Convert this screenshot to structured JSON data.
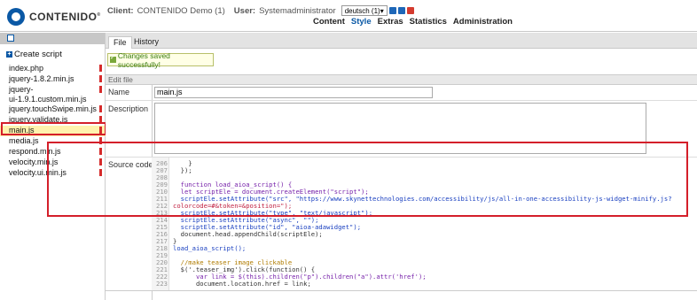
{
  "header": {
    "logo_text": "CONTENIDO",
    "client_label": "Client:",
    "client_value": "CONTENIDO Demo (1)",
    "user_label": "User:",
    "user_value": "Systemadministrator",
    "language": "deutsch (1)",
    "nav": [
      "Content",
      "Style",
      "Extras",
      "Statistics",
      "Administration"
    ],
    "active_nav": "Style"
  },
  "sidebar": {
    "create_label": "Create script",
    "files": [
      {
        "name": "index.php",
        "tall": false
      },
      {
        "name": "jquery-1.8.2.min.js",
        "tall": false
      },
      {
        "name": "jquery-\nui-1.9.1.custom.min.js",
        "tall": true
      },
      {
        "name": "jquery.touchSwipe.min.js",
        "tall": false
      },
      {
        "name": "jquery.validate.js",
        "tall": false
      },
      {
        "name": "main.js",
        "tall": false,
        "selected": true
      },
      {
        "name": "media.js",
        "tall": false
      },
      {
        "name": "respond.min.js",
        "tall": false
      },
      {
        "name": "velocity.min.js",
        "tall": false
      },
      {
        "name": "velocity.ui.min.js",
        "tall": false
      }
    ]
  },
  "main": {
    "tabs": [
      "File",
      "History"
    ],
    "active_tab": "File",
    "notice": "Changes saved successfully!",
    "section_title": "Edit file",
    "name_label": "Name",
    "name_value": "main.js",
    "description_label": "Description",
    "source_label": "Source code",
    "code_lines": [
      {
        "n": "206",
        "t": "    }"
      },
      {
        "n": "207",
        "t": "  });"
      },
      {
        "n": "208",
        "t": ""
      },
      {
        "n": "209",
        "t": "  function load_aioa_script() {"
      },
      {
        "n": "210",
        "t": "  let scriptEle = document.createElement(\"script\");"
      },
      {
        "n": "211",
        "t": "  scriptEle.setAttribute(\"src\", \"https://www.skynettechnologies.com/accessibility/js/all-in-one-accessibility-js-widget-minify.js?"
      },
      {
        "n": "212",
        "t": "colorcode=#&token=&position=\");"
      },
      {
        "n": "213",
        "t": "  scriptEle.setAttribute(\"type\", \"text/javascript\");"
      },
      {
        "n": "214",
        "t": "  scriptEle.setAttribute(\"async\", \"\");"
      },
      {
        "n": "215",
        "t": "  scriptEle.setAttribute(\"id\", \"aioa-adawidget\");"
      },
      {
        "n": "216",
        "t": "  document.head.appendChild(scriptEle);"
      },
      {
        "n": "217",
        "t": "}"
      },
      {
        "n": "218",
        "t": "load_aioa_script();"
      },
      {
        "n": "219",
        "t": ""
      },
      {
        "n": "220",
        "t": "  //make teaser image clickable"
      },
      {
        "n": "221",
        "t": "  $('.teaser_img').click(function() {"
      },
      {
        "n": "222",
        "t": "      var link = $(this).children(\"p\").children(\"a\").attr('href');"
      },
      {
        "n": "223",
        "t": "      document.location.href = link;"
      }
    ]
  },
  "colors": {
    "accent": "#0a58a5",
    "highlight_box": "#d41f2a",
    "selected_bg": "#fff2ad"
  }
}
